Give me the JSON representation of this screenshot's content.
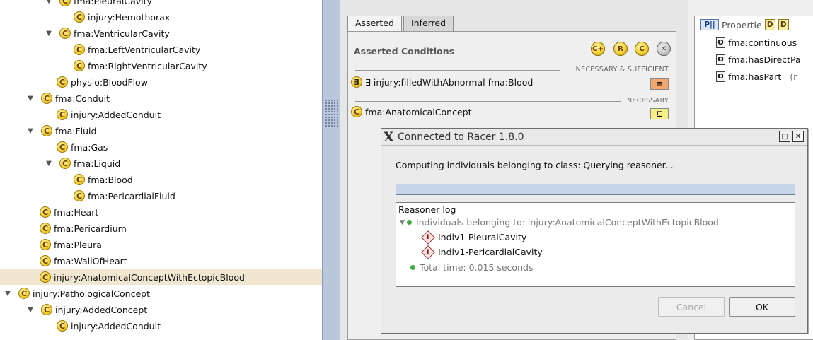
{
  "tree": {
    "rows": [
      {
        "toggle": "▼",
        "label": "fma:PleuralCavity"
      },
      {
        "toggle": "",
        "label": "injury:Hemothorax"
      },
      {
        "toggle": "▼",
        "label": "fma:VentricularCavity"
      },
      {
        "toggle": "",
        "label": "fma:LeftVentricularCavity"
      },
      {
        "toggle": "",
        "label": "fma:RightVentricularCavity"
      },
      {
        "toggle": "",
        "label": "physio:BloodFlow"
      },
      {
        "toggle": "▼",
        "label": "fma:Conduit"
      },
      {
        "toggle": "",
        "label": "injury:AddedConduit"
      },
      {
        "toggle": "▼",
        "label": "fma:Fluid"
      },
      {
        "toggle": "",
        "label": "fma:Gas"
      },
      {
        "toggle": "▼",
        "label": "fma:Liquid"
      },
      {
        "toggle": "",
        "label": "fma:Blood"
      },
      {
        "toggle": "",
        "label": "fma:PericardialFluid"
      },
      {
        "toggle": "",
        "label": "fma:Heart"
      },
      {
        "toggle": "",
        "label": "fma:Pericardium"
      },
      {
        "toggle": "",
        "label": "fma:Pleura"
      },
      {
        "toggle": "",
        "label": "fma:WallOfHeart"
      },
      {
        "toggle": "",
        "label": "injury:AnatomicalConceptWithEctopicBlood"
      },
      {
        "toggle": "▼",
        "label": "injury:PathologicalConcept"
      },
      {
        "toggle": "▼",
        "label": "injury:AddedConcept"
      },
      {
        "toggle": "",
        "label": "injury:AddedConduit"
      }
    ],
    "class_icon": "C"
  },
  "middle": {
    "tabs": [
      "Asserted",
      "Inferred"
    ],
    "header": "Asserted Conditions",
    "header_icons": [
      "add-class-icon",
      "add-restriction-icon",
      "add-named-class-icon",
      "delete-icon"
    ],
    "sections": [
      {
        "label": "NECESSARY & SUFFICIENT",
        "condition": "∃ injury:filledWithAbnormal fma:Blood",
        "icon": "∃",
        "badge": "≡"
      },
      {
        "label": "NECESSARY",
        "condition": "fma:AnatomicalConcept",
        "icon": "C",
        "badge": "⊑"
      }
    ]
  },
  "right": {
    "header_badge": "P||",
    "header": "Propertie",
    "properties": [
      {
        "label": "fma:continuous",
        "extra": ""
      },
      {
        "label": "fma:hasDirectPa",
        "extra": ""
      },
      {
        "label": "fma:hasPart",
        "extra": "(r"
      }
    ]
  },
  "dialog": {
    "title": "Connected to Racer 1.8.0",
    "status": "Computing individuals belonging to class: Querying reasoner...",
    "progress": 1.0,
    "log_title": "Reasoner log",
    "log_root": "Individuals belonging to: injury:AnatomicalConceptWithEctopicBlood",
    "individuals": [
      "Indiv1-PleuralCavity",
      "Indiv1-PericardialCavity"
    ],
    "total_time": "Total time: 0.015 seconds",
    "cancel_label": "Cancel",
    "ok_label": "OK"
  }
}
